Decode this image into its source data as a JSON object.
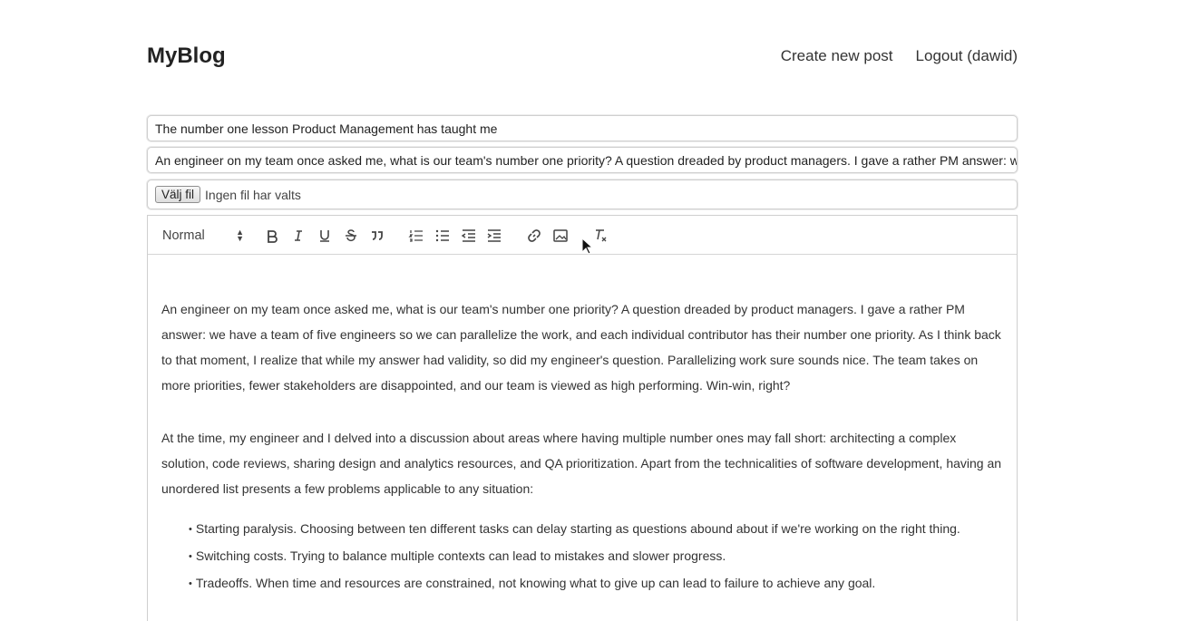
{
  "header": {
    "brand": "MyBlog",
    "nav": {
      "create": "Create new post",
      "logout": "Logout (dawid)"
    }
  },
  "form": {
    "title_value": "The number one lesson Product Management has taught me",
    "summary_value": "An engineer on my team once asked me, what is our team's number one priority? A question dreaded by product managers. I gave a rather PM answer: we h",
    "file_button": "Välj fil",
    "file_status": "Ingen fil har valts"
  },
  "toolbar": {
    "header_select": "Normal",
    "icons": [
      "bold-icon",
      "italic-icon",
      "underline-icon",
      "strike-icon",
      "blockquote-icon",
      "ordered-list-icon",
      "bullet-list-icon",
      "outdent-icon",
      "indent-icon",
      "link-icon",
      "image-icon",
      "clean-format-icon"
    ]
  },
  "editor": {
    "paragraphs": [
      "An engineer on my team once asked me, what is our team's number one priority? A question dreaded by product managers. I gave a rather PM answer: we have a team of five engineers so we can parallelize the work, and each individual contributor has their number one priority. As I think back to that moment, I realize that while my answer had validity, so did my engineer's question. Parallelizing work sure sounds nice. The team takes on more priorities, fewer stakeholders are disappointed, and our team is viewed as high performing. Win-win, right?",
      "At the time, my engineer and I delved into a discussion about areas where having multiple number ones may fall short: architecting a complex solution, code reviews, sharing design and analytics resources, and QA prioritization. Apart from the technicalities of software development, having an unordered list presents a few problems applicable to any situation:"
    ],
    "bullets": [
      "Starting paralysis. Choosing between ten different tasks can delay starting as questions abound about if we're working on the right thing.",
      "Switching costs. Trying to balance multiple contexts can lead to mistakes and slower progress.",
      "Tradeoffs. When time and resources are constrained, not knowing what to give up can lead to failure to achieve any goal."
    ]
  }
}
